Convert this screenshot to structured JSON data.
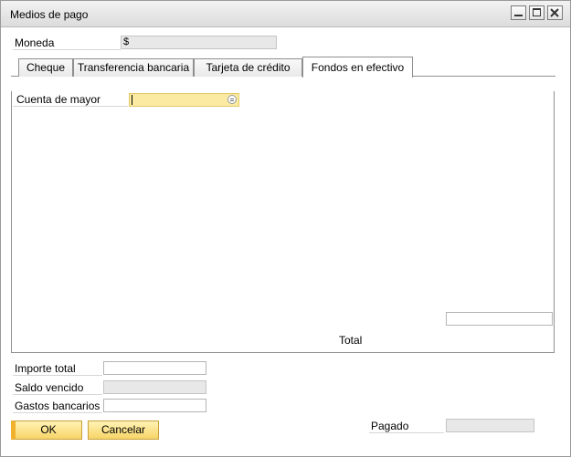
{
  "window": {
    "title": "Medios de pago"
  },
  "header": {
    "currency_label": "Moneda",
    "currency_value": "$"
  },
  "tabs": [
    {
      "label": "Cheque",
      "selected": false
    },
    {
      "label": "Transferencia bancaria",
      "selected": false
    },
    {
      "label": "Tarjeta de crédito",
      "selected": false
    },
    {
      "label": "Fondos en efectivo",
      "selected": true
    }
  ],
  "cash_tab": {
    "account_label": "Cuenta de mayor",
    "account_value": "",
    "total_label": "Total",
    "total_value": ""
  },
  "footer": {
    "total_amount_label": "Importe total",
    "total_amount_value": "",
    "overdue_label": "Saldo vencido",
    "overdue_value": "",
    "bank_charges_label": "Gastos bancarios",
    "bank_charges_value": "",
    "paid_label": "Pagado",
    "paid_value": ""
  },
  "buttons": {
    "ok": "OK",
    "cancel": "Cancelar"
  },
  "colors": {
    "active_field": "#fbeaa1",
    "button_gold": "#f7d467",
    "readonly_field": "#e8e8e8"
  }
}
